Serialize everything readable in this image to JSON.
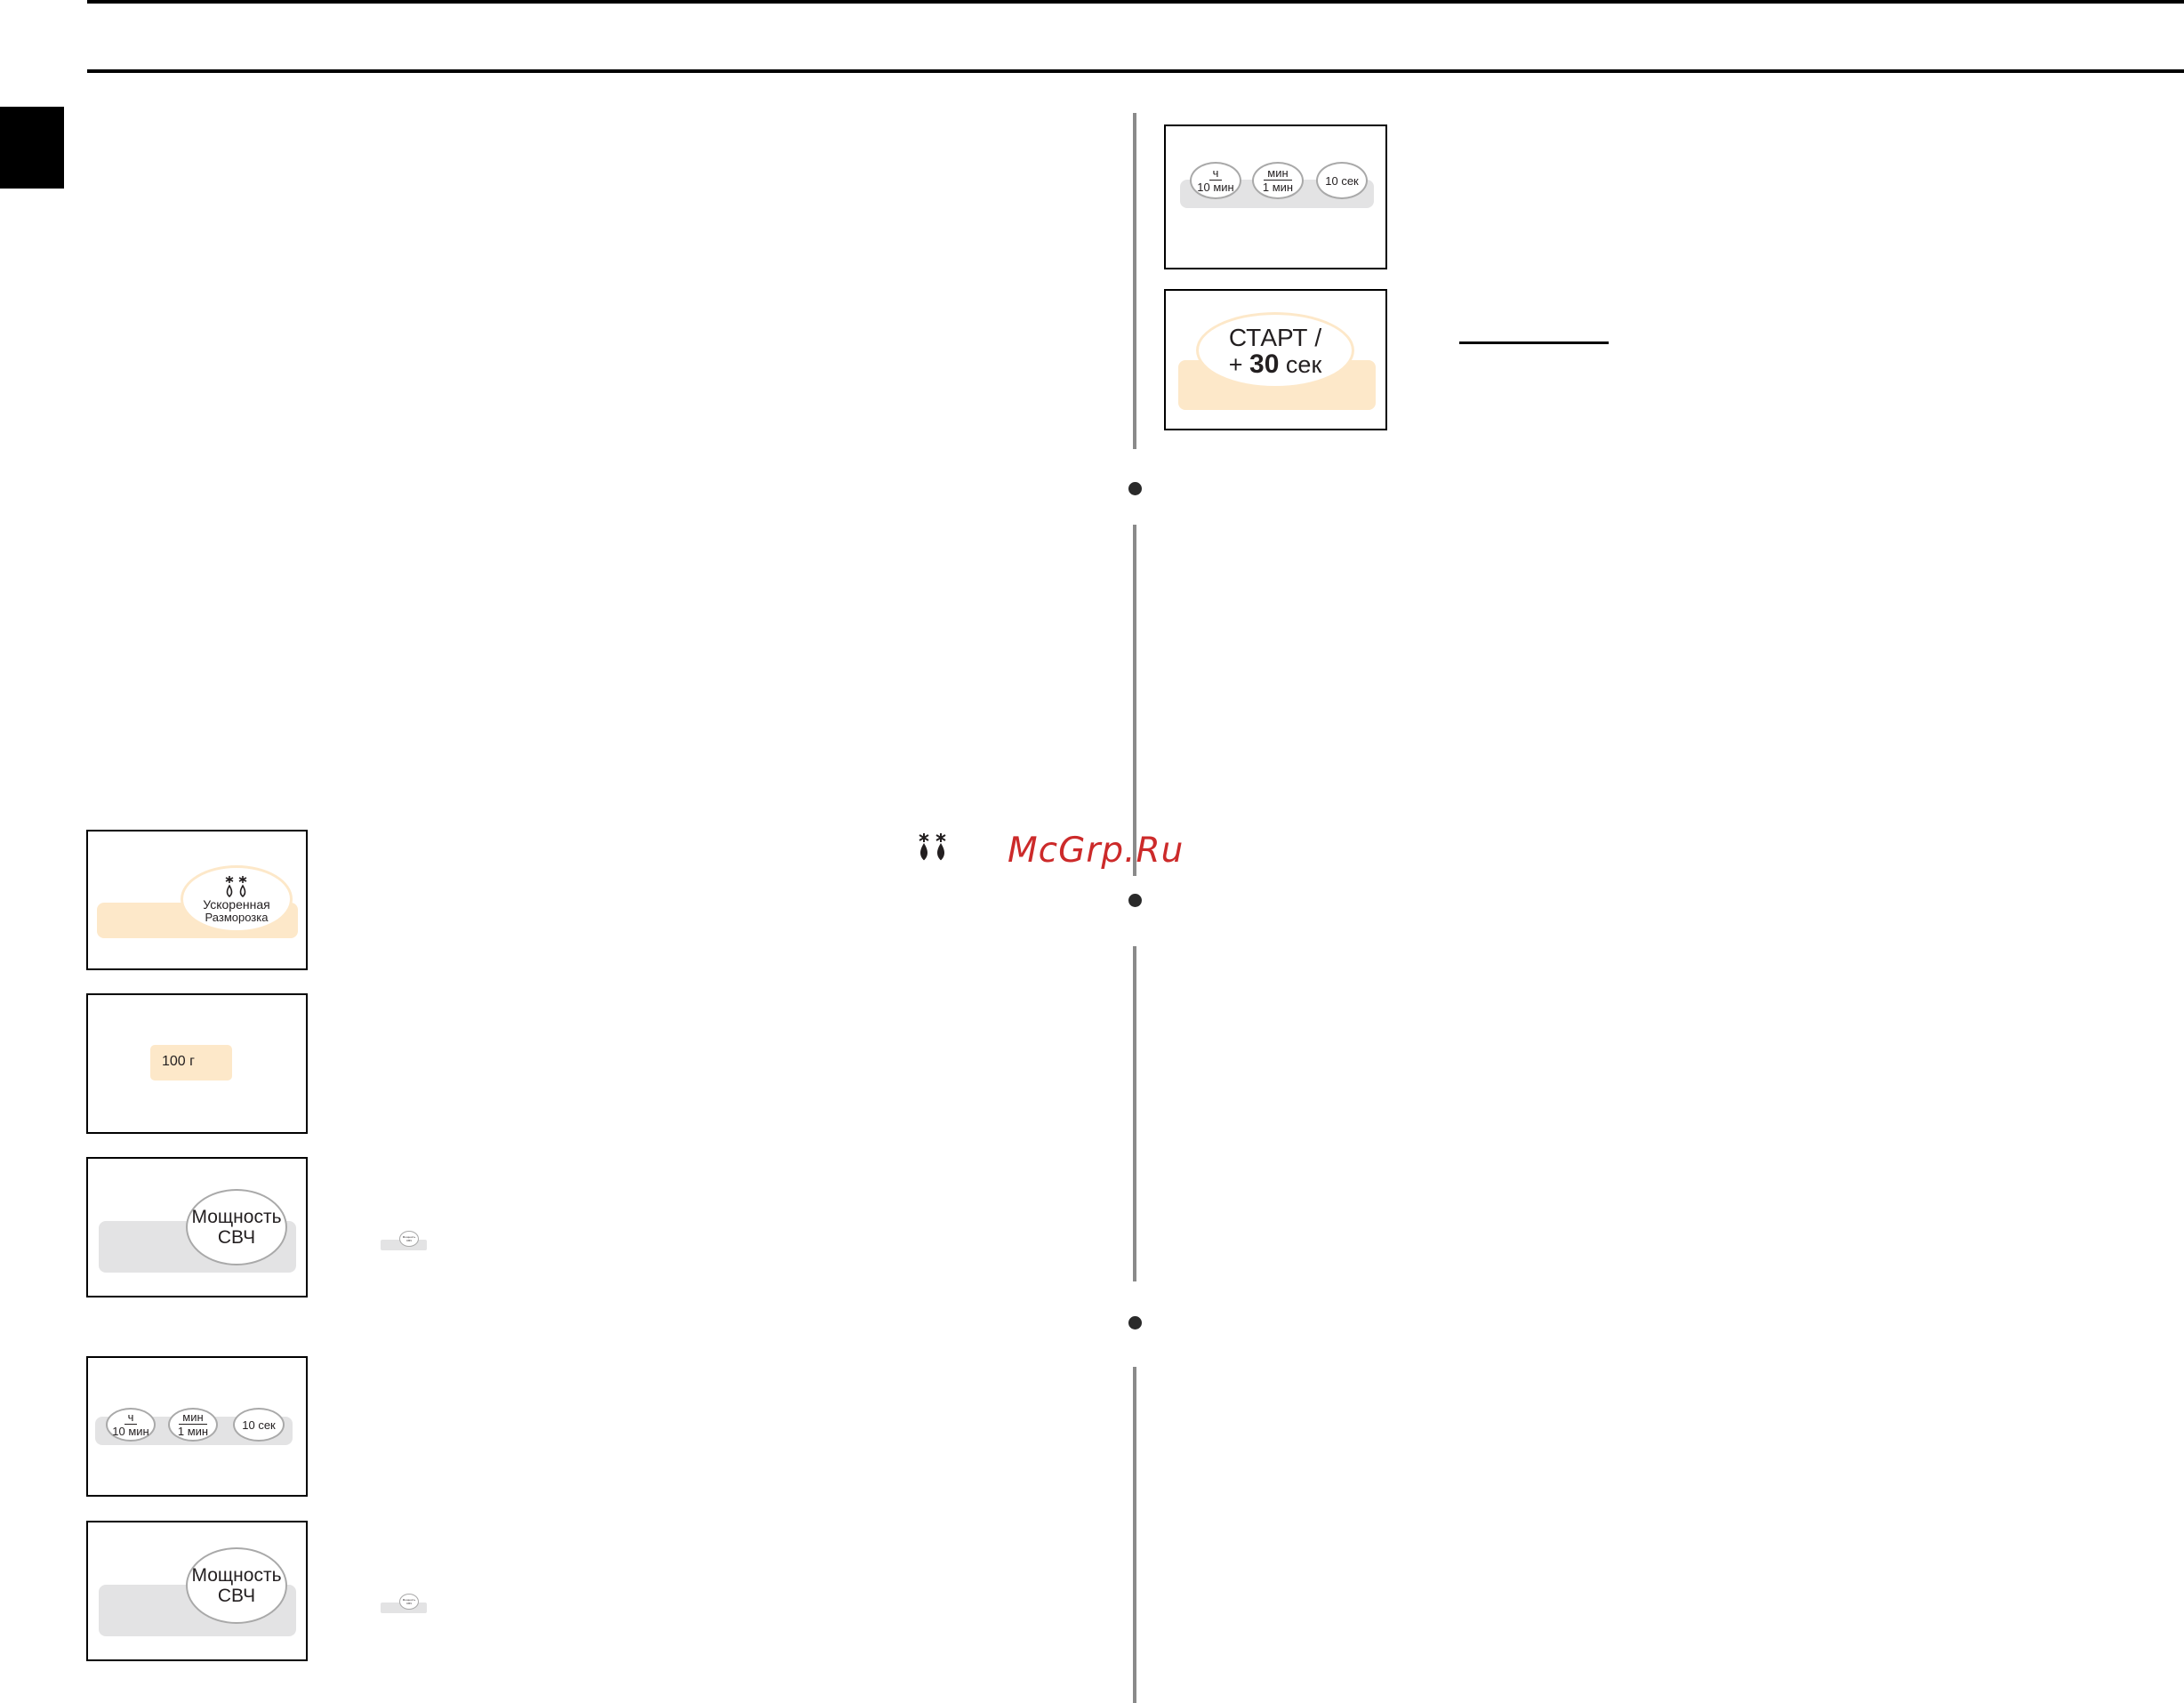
{
  "watermark": "McGrp.Ru",
  "panels": {
    "time_keys": {
      "hour_top": "ч",
      "hour_bottom": "10 мин",
      "min_top": "мин",
      "min_bottom": "1 мин",
      "sec": "10 сек"
    },
    "start": {
      "line1": "СТАРТ /",
      "line2_sign": "+",
      "line2_num": "30",
      "line2_unit": "сек"
    },
    "defrost": {
      "label1": "Ускоренная",
      "label2": "Разморозка"
    },
    "weight": {
      "value": "100 г"
    },
    "power": {
      "label1": "Мощность",
      "label2": "СВЧ"
    },
    "power_small": {
      "label1": "Мощность",
      "label2": "СВЧ"
    }
  },
  "colors": {
    "peach": "#fde8c9",
    "grey_bar": "#e3e3e4",
    "rule": "#000000",
    "divider": "#8a8a8a"
  }
}
